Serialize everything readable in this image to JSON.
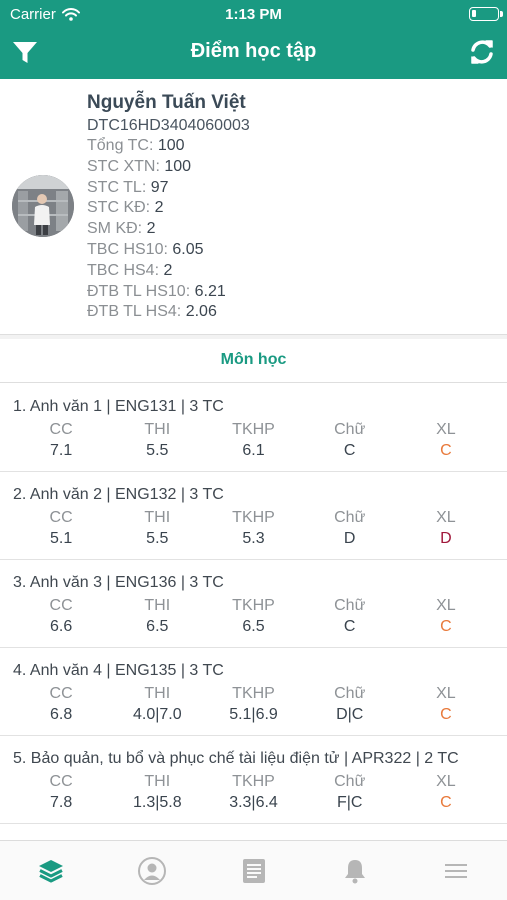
{
  "status_bar": {
    "carrier": "Carrier",
    "time": "1:13 PM"
  },
  "header": {
    "title": "Điểm học tập"
  },
  "student": {
    "name": "Nguyễn Tuấn Việt",
    "id": "DTC16HD3404060003",
    "stats": [
      {
        "label": "Tổng TC:",
        "value": "100"
      },
      {
        "label": "STC XTN:",
        "value": "100"
      },
      {
        "label": "STC TL:",
        "value": "97"
      },
      {
        "label": "STC KĐ:",
        "value": "2"
      },
      {
        "label": "SM KĐ:",
        "value": "2"
      },
      {
        "label": "TBC HS10:",
        "value": "6.05"
      },
      {
        "label": "TBC HS4:",
        "value": "2"
      },
      {
        "label": "ĐTB TL HS10:",
        "value": "6.21"
      },
      {
        "label": "ĐTB TL HS4:",
        "value": "2.06"
      }
    ]
  },
  "section": {
    "title": "Môn học"
  },
  "columns": [
    "CC",
    "THI",
    "TKHP",
    "Chữ",
    "XL"
  ],
  "colors": {
    "primary": "#1a9a82",
    "grade_c": "#e8793a",
    "grade_d": "#a0173a"
  },
  "courses": [
    {
      "title": "1. Anh văn 1 | ENG131 | 3 TC",
      "cc": "7.1",
      "thi": "5.5",
      "tkhp": "6.1",
      "chu": "C",
      "xl": "C",
      "xl_color": "#e8793a"
    },
    {
      "title": "2. Anh văn 2 | ENG132 | 3 TC",
      "cc": "5.1",
      "thi": "5.5",
      "tkhp": "5.3",
      "chu": "D",
      "xl": "D",
      "xl_color": "#a0173a"
    },
    {
      "title": "3. Anh văn 3 | ENG136 | 3 TC",
      "cc": "6.6",
      "thi": "6.5",
      "tkhp": "6.5",
      "chu": "C",
      "xl": "C",
      "xl_color": "#e8793a"
    },
    {
      "title": "4. Anh văn 4 | ENG135 | 3 TC",
      "cc": "6.8",
      "thi": "4.0|7.0",
      "tkhp": "5.1|6.9",
      "chu": "D|C",
      "xl": "C",
      "xl_color": "#e8793a"
    },
    {
      "title": "5. Bảo quản, tu bổ và phục chế tài liệu điện tử | APR322 | 2 TC",
      "cc": "7.8",
      "thi": "1.3|5.8",
      "tkhp": "3.3|6.4",
      "chu": "F|C",
      "xl": "C",
      "xl_color": "#e8793a"
    }
  ],
  "tabs": [
    {
      "icon": "layers-icon",
      "active": true
    },
    {
      "icon": "profile-icon",
      "active": false
    },
    {
      "icon": "document-icon",
      "active": false
    },
    {
      "icon": "bell-icon",
      "active": false
    },
    {
      "icon": "menu-icon",
      "active": false
    }
  ]
}
